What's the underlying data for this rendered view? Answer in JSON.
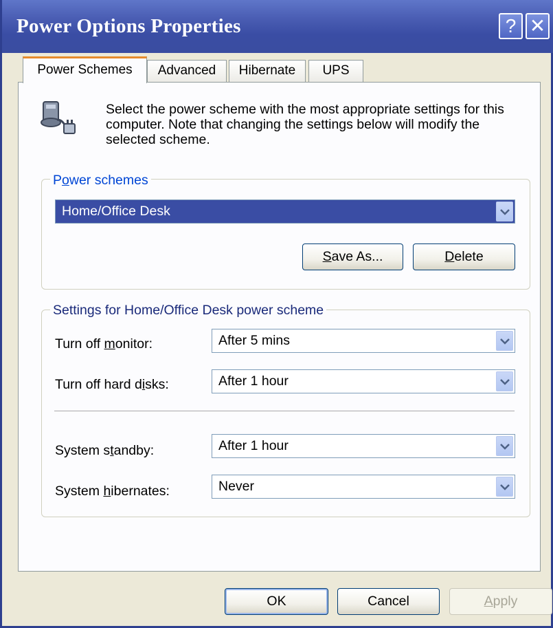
{
  "window": {
    "title": "Power Options Properties",
    "help_glyph": "?",
    "close_glyph": "✕"
  },
  "tabs": [
    {
      "label": "Power Schemes"
    },
    {
      "label": "Advanced"
    },
    {
      "label": "Hibernate"
    },
    {
      "label": "UPS"
    }
  ],
  "intro": "Select the power scheme with the most appropriate settings for this computer. Note that changing the settings below will modify the selected scheme.",
  "power_schemes": {
    "group_label_pre": "P",
    "group_label_accel": "o",
    "group_label_post": "wer schemes",
    "selected": "Home/Office Desk",
    "save_as": {
      "accel": "S",
      "rest": "ave As..."
    },
    "delete": {
      "accel": "D",
      "rest": "elete"
    }
  },
  "settings": {
    "group_label": "Settings for Home/Office Desk power scheme",
    "monitor": {
      "label_pre": "Turn off ",
      "label_accel": "m",
      "label_post": "onitor:",
      "value": "After 5 mins"
    },
    "hard_disks": {
      "label_pre": "Turn off hard d",
      "label_accel": "i",
      "label_post": "sks:",
      "value": "After 1 hour"
    },
    "standby": {
      "label_pre": "System s",
      "label_accel": "t",
      "label_post": "andby:",
      "value": "After 1 hour"
    },
    "hibernates": {
      "label_pre": "System ",
      "label_accel": "h",
      "label_post": "ibernates:",
      "value": "Never"
    }
  },
  "buttons": {
    "ok": "OK",
    "cancel": "Cancel",
    "apply": {
      "accel": "A",
      "rest": "pply"
    }
  },
  "colors": {
    "titlebar": "#3a4da4",
    "face": "#ece9d8",
    "selection": "#3a4da4",
    "tab_highlight": "#e68b2c"
  },
  "icons": {
    "power": "power-plug-computer-icon",
    "dropdown": "chevron-down-icon"
  }
}
